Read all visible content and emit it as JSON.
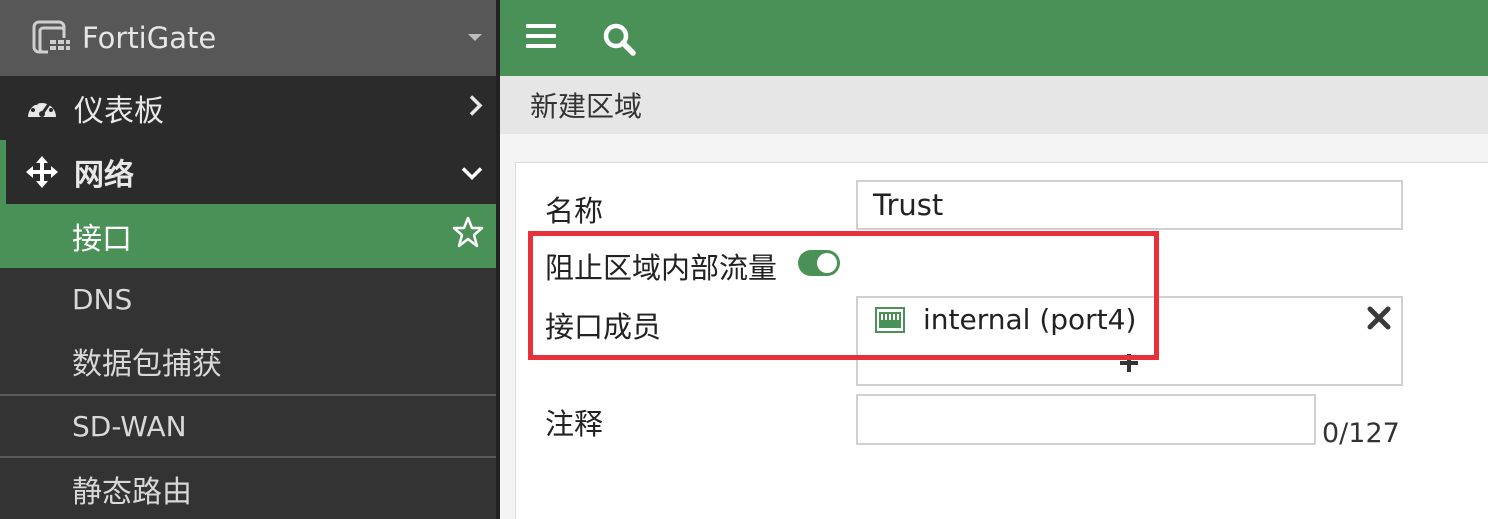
{
  "brand": {
    "title": "FortiGate"
  },
  "sidebar": {
    "items": [
      {
        "label": "仪表板",
        "icon": "dashboard-icon"
      },
      {
        "label": "网络",
        "icon": "move-arrows-icon"
      },
      {
        "label": "接口"
      },
      {
        "label": "DNS"
      },
      {
        "label": "数据包捕获"
      },
      {
        "label": "SD-WAN"
      },
      {
        "label": "静态路由"
      }
    ]
  },
  "page": {
    "title": "新建区域"
  },
  "form": {
    "name_label": "名称",
    "name_value": "Trust",
    "block_label": "阻止区域内部流量",
    "block_enabled": true,
    "members_label": "接口成员",
    "members": [
      "internal (port4)"
    ],
    "comment_label": "注释",
    "comment_value": "",
    "comment_counter": "0/127"
  },
  "colors": {
    "accent": "#4a9157",
    "highlight": "#e8303a",
    "sidebar_bg": "#333333"
  }
}
